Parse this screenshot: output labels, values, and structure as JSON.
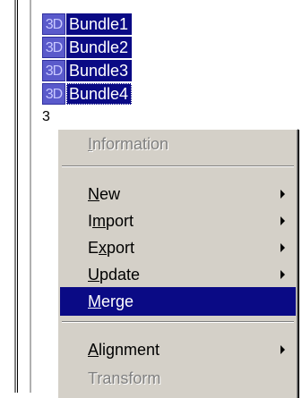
{
  "tree": {
    "items": [
      {
        "badge": "3D",
        "label": "Bundle1"
      },
      {
        "badge": "3D",
        "label": "Bundle2"
      },
      {
        "badge": "3D",
        "label": "Bundle3"
      },
      {
        "badge": "3D",
        "label": "Bundle4"
      },
      {
        "badge": "3",
        "label": ""
      }
    ]
  },
  "context_menu": {
    "items": [
      {
        "pre": "",
        "key": "I",
        "post": "nformation"
      },
      {
        "pre": "",
        "key": "N",
        "post": "ew"
      },
      {
        "pre": "I",
        "key": "m",
        "post": "port"
      },
      {
        "pre": "E",
        "key": "x",
        "post": "port"
      },
      {
        "pre": "",
        "key": "U",
        "post": "pdate"
      },
      {
        "pre": "",
        "key": "M",
        "post": "erge"
      },
      {
        "pre": "",
        "key": "A",
        "post": "lignment"
      },
      {
        "pre": "",
        "key": "",
        "post": "Transform"
      }
    ]
  },
  "colors": {
    "selection": "#0a0a85",
    "menu_bg": "#d4d0c8",
    "badge": "#5a5acb"
  }
}
